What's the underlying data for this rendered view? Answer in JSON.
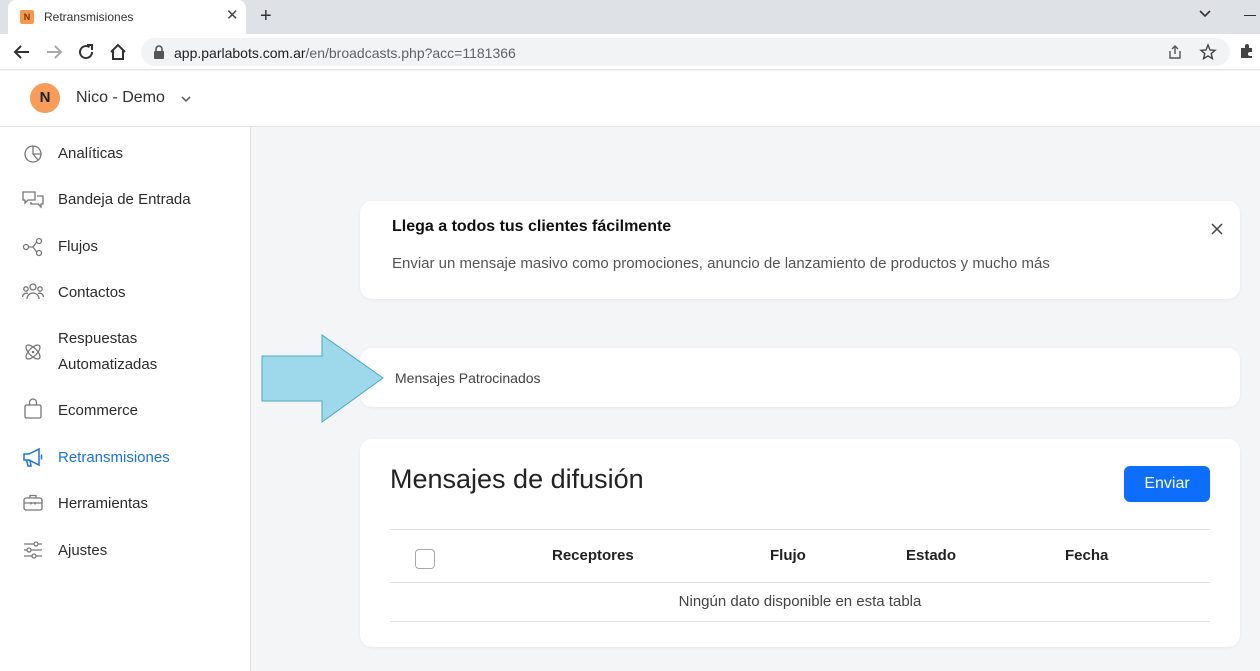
{
  "browser": {
    "tab_favicon": "N",
    "tab_title": "Retransmisiones",
    "url_host": "app.parlabots.com.ar",
    "url_path": "/en/broadcasts.php?acc=1181366"
  },
  "account": {
    "avatar_letter": "N",
    "name": "Nico - Demo"
  },
  "sidebar": {
    "items": [
      {
        "label": "Analíticas",
        "icon": "pie-chart-icon"
      },
      {
        "label": "Bandeja de Entrada",
        "icon": "chat-bubbles-icon"
      },
      {
        "label": "Flujos",
        "icon": "flow-icon"
      },
      {
        "label": "Contactos",
        "icon": "users-icon"
      },
      {
        "label": "Respuestas",
        "label2": "Automatizadas",
        "icon": "atom-icon"
      },
      {
        "label": "Ecommerce",
        "icon": "shopping-bag-icon"
      },
      {
        "label": "Retransmisiones",
        "icon": "megaphone-icon",
        "active": true
      },
      {
        "label": "Herramientas",
        "icon": "toolbox-icon"
      },
      {
        "label": "Ajustes",
        "icon": "sliders-icon"
      }
    ],
    "active_color": "#1a73e8"
  },
  "promo": {
    "title": "Llega a todos tus clientes fácilmente",
    "text": "Enviar un mensaje masivo como promociones, anuncio de lanzamiento de productos y mucho más"
  },
  "sponsored": {
    "label": "Mensajes Patrocinados"
  },
  "broadcasts": {
    "title": "Mensajes de difusión",
    "send_label": "Enviar",
    "columns": [
      "Receptores",
      "Flujo",
      "Estado",
      "Fecha"
    ],
    "empty_text": "Ningún dato disponible en esta tabla"
  },
  "colors": {
    "primary": "#0d6efd",
    "avatar": "#f89c5a",
    "arrow": "#9dd9ea"
  }
}
